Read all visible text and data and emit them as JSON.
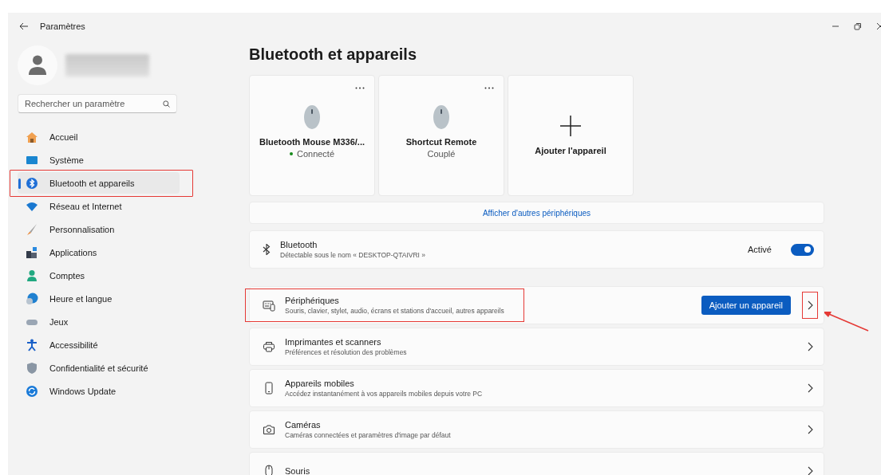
{
  "window": {
    "title": "Paramètres"
  },
  "sidebar": {
    "search": {
      "placeholder": "Rechercher un paramètre"
    },
    "items": [
      {
        "label": "Accueil",
        "selected": false,
        "highlighted": false
      },
      {
        "label": "Système",
        "selected": false,
        "highlighted": false
      },
      {
        "label": "Bluetooth et appareils",
        "selected": true,
        "highlighted": true
      },
      {
        "label": "Réseau et Internet",
        "selected": false,
        "highlighted": false
      },
      {
        "label": "Personnalisation",
        "selected": false,
        "highlighted": false
      },
      {
        "label": "Applications",
        "selected": false,
        "highlighted": false
      },
      {
        "label": "Comptes",
        "selected": false,
        "highlighted": false
      },
      {
        "label": "Heure et langue",
        "selected": false,
        "highlighted": false
      },
      {
        "label": "Jeux",
        "selected": false,
        "highlighted": false
      },
      {
        "label": "Accessibilité",
        "selected": false,
        "highlighted": false
      },
      {
        "label": "Confidentialité et sécurité",
        "selected": false,
        "highlighted": false
      },
      {
        "label": "Windows Update",
        "selected": false,
        "highlighted": false
      }
    ]
  },
  "page": {
    "title": "Bluetooth et appareils"
  },
  "devices": [
    {
      "kind": "device",
      "name": "Bluetooth Mouse M336/...",
      "status": "Connecté",
      "connected": true
    },
    {
      "kind": "device",
      "name": "Shortcut Remote",
      "status": "Couplé",
      "connected": false
    },
    {
      "kind": "add",
      "label": "Ajouter l'appareil"
    }
  ],
  "more_link": "Afficher d'autres périphériques",
  "bluetooth": {
    "title": "Bluetooth",
    "subtitle": "Détectable sous le nom « DESKTOP-QTAIVRI »",
    "state_label": "Activé",
    "on": true
  },
  "rows": [
    {
      "title": "Périphériques",
      "subtitle": "Souris, clavier, stylet, audio, écrans et stations d'accueil, autres appareils",
      "button": "Ajouter un appareil",
      "highlighted": true,
      "chevron_highlighted": true
    },
    {
      "title": "Imprimantes et scanners",
      "subtitle": "Préférences et résolution des problèmes",
      "highlighted": false,
      "chevron_highlighted": false
    },
    {
      "title": "Appareils mobiles",
      "subtitle": "Accédez instantanément à vos appareils mobiles depuis votre PC",
      "highlighted": false,
      "chevron_highlighted": false
    },
    {
      "title": "Caméras",
      "subtitle": "Caméras connectées et paramètres d'image par défaut",
      "highlighted": false,
      "chevron_highlighted": false
    },
    {
      "title": "Souris",
      "highlighted": false,
      "chevron_highlighted": false
    }
  ]
}
